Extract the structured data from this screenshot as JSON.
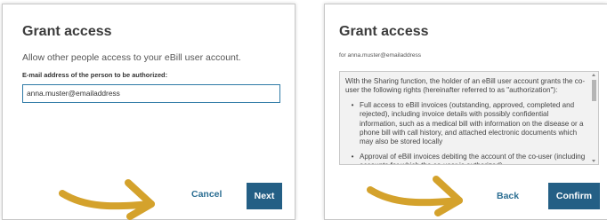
{
  "dialog_left": {
    "title": "Grant access",
    "intro": "Allow other people access to your eBill user account.",
    "field_label": "E-mail address of the person to be authorized:",
    "email_value": "anna.muster@emailaddress",
    "cancel_label": "Cancel",
    "next_label": "Next"
  },
  "dialog_right": {
    "title": "Grant access",
    "subtitle": "for anna.muster@emailaddress",
    "terms_intro": "With the Sharing function, the holder of an eBill user account grants the co-user the following rights (hereinafter referred to as \"authorization\"):",
    "terms_bullets": [
      "Full access to eBill invoices (outstanding, approved, completed and rejected), including invoice details with possibly confidential information, such as a medical bill with information on the disease or a phone bill with call history, and attached electronic documents which may also be stored locally",
      "Approval of eBill invoices debiting the account of the co-user (including accounts for which the co-user is authorized)"
    ],
    "back_label": "Back",
    "confirm_label": "Confirm"
  },
  "colors": {
    "primary": "#245f85",
    "link": "#2d6f93",
    "input_border": "#2f7aa6",
    "arrow": "#d4a22c"
  },
  "icons": {
    "arrow": "right-pointing-arrow",
    "scroll_up": "triangle-up",
    "scroll_down": "triangle-down"
  }
}
